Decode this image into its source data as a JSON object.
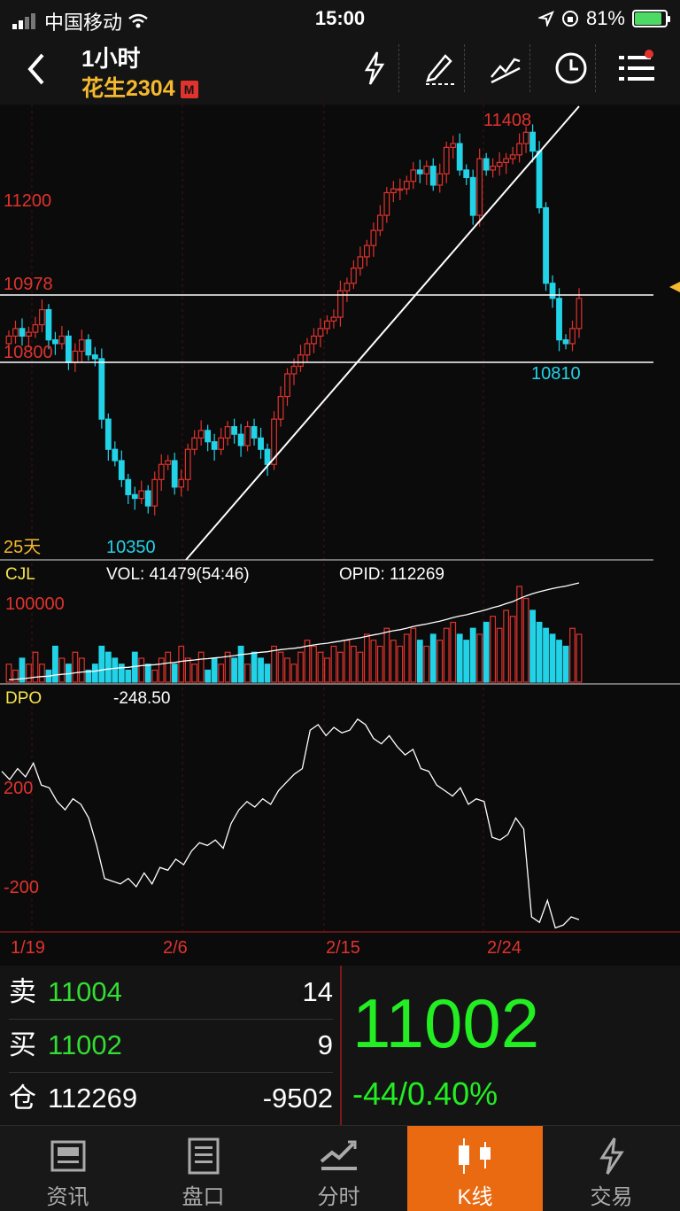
{
  "status_bar": {
    "carrier": "中国移动",
    "time": "15:00",
    "battery": "81%"
  },
  "header": {
    "timeframe": "1小时",
    "contract": "花生2304",
    "badge": "M"
  },
  "toolbar": {
    "icons": [
      "lightning-icon",
      "pen-icon",
      "trendline-icon",
      "clock-icon",
      "menu-icon"
    ]
  },
  "chart": {
    "price_labels": {
      "l11200": "11200",
      "l10978": "10978",
      "l10800": "10800",
      "high": "11408",
      "low": "10350",
      "recent_low": "10810"
    },
    "period": "25天",
    "volume_panel": {
      "name": "CJL",
      "vol": "VOL: 41479(54:46)",
      "opid": "OPID: 112269",
      "scale": "100000"
    },
    "dpo_panel": {
      "name": "DPO",
      "value": "-248.50",
      "l200": "200",
      "lm200": "-200"
    },
    "dates": [
      "1/19",
      "2/6",
      "2/15",
      "2/24"
    ]
  },
  "chart_data": {
    "type": "candlestick",
    "price_range": [
      10300,
      11450
    ],
    "horizontal_lines": [
      10978,
      10800
    ],
    "candles_close": [
      10860,
      10880,
      10860,
      10870,
      10890,
      10930,
      10850,
      10840,
      10860,
      10790,
      10820,
      10850,
      10810,
      10800,
      10640,
      10560,
      10530,
      10480,
      10440,
      10430,
      10450,
      10410,
      10480,
      10520,
      10530,
      10460,
      10480,
      10560,
      10590,
      10610,
      10580,
      10560,
      10590,
      10620,
      10600,
      10570,
      10620,
      10590,
      10560,
      10520,
      10640,
      10700,
      10760,
      10780,
      10810,
      10840,
      10860,
      10880,
      10900,
      10910,
      10980,
      11000,
      11040,
      11070,
      11100,
      11140,
      11180,
      11240,
      11250,
      11250,
      11270,
      11300,
      11290,
      11310,
      11260,
      11290,
      11360,
      11370,
      11300,
      11280,
      11180,
      11330,
      11300,
      11310,
      11320,
      11330,
      11340,
      11370,
      11400,
      11350,
      11200,
      11000,
      10960,
      10850,
      10840,
      10880,
      10960
    ],
    "volume_series": [
      3,
      2,
      4,
      3,
      5,
      3,
      2,
      6,
      4,
      3,
      5,
      4,
      2,
      3,
      6,
      5,
      4,
      3,
      2,
      5,
      4,
      3,
      2,
      4,
      5,
      3,
      6,
      4,
      3,
      5,
      2,
      4,
      3,
      5,
      4,
      6,
      3,
      5,
      4,
      3,
      6,
      5,
      4,
      3,
      5,
      7,
      6,
      5,
      4,
      6,
      5,
      7,
      6,
      5,
      8,
      7,
      6,
      9,
      7,
      6,
      8,
      9,
      7,
      6,
      8,
      7,
      9,
      10,
      8,
      7,
      9,
      8,
      10,
      11,
      9,
      12,
      11,
      16,
      14,
      12,
      10,
      9,
      8,
      7,
      6,
      9,
      8
    ],
    "dpo_series": [
      230,
      200,
      240,
      210,
      260,
      180,
      170,
      120,
      90,
      130,
      110,
      60,
      -40,
      -160,
      -170,
      -180,
      -160,
      -190,
      -140,
      -180,
      -120,
      -130,
      -90,
      -110,
      -60,
      -30,
      -40,
      -20,
      -50,
      40,
      90,
      120,
      100,
      130,
      110,
      160,
      190,
      220,
      240,
      380,
      400,
      360,
      390,
      370,
      380,
      420,
      400,
      350,
      330,
      360,
      320,
      290,
      310,
      240,
      230,
      180,
      160,
      140,
      170,
      110,
      130,
      120,
      -10,
      -20,
      0,
      60,
      20,
      -300,
      -320,
      -240,
      -340,
      -330,
      -300,
      -310
    ],
    "dates": [
      "1/19",
      "2/6",
      "2/15",
      "2/24"
    ]
  },
  "quote": {
    "sell_label": "卖",
    "sell_price": "11004",
    "sell_vol": "14",
    "buy_label": "买",
    "buy_price": "11002",
    "buy_vol": "9",
    "oi_label": "仓",
    "oi": "112269",
    "oi_change": "-9502",
    "last_price": "11002",
    "change": "-44/0.40%"
  },
  "tabs": [
    {
      "label": "资讯",
      "icon": "news-icon"
    },
    {
      "label": "盘口",
      "icon": "orderbook-icon"
    },
    {
      "label": "分时",
      "icon": "timeshare-icon"
    },
    {
      "label": "K线",
      "icon": "candlestick-icon"
    },
    {
      "label": "交易",
      "icon": "trade-icon"
    }
  ],
  "colors": {
    "up": "#e0332e",
    "down": "#22d3e8",
    "accent": "#ea6a12",
    "gain_text": "#22ee22"
  }
}
